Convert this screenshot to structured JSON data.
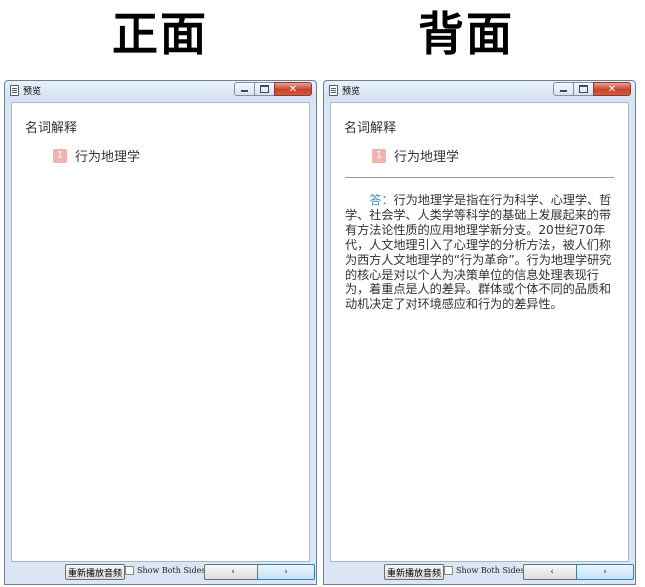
{
  "headings": {
    "front": "正面",
    "back": "背面"
  },
  "windows": [
    {
      "title": "预览",
      "category": "名词解释",
      "item_number": "1",
      "term": "行为地理学",
      "show_answer": false,
      "answer_label": "",
      "answer_text": "",
      "replay_label": "重新播放音频",
      "show_both_label": "Show Both Sides",
      "prev_icon": "‹",
      "next_icon": "›"
    },
    {
      "title": "预览",
      "category": "名词解释",
      "item_number": "1",
      "term": "行为地理学",
      "show_answer": true,
      "answer_label": "答：",
      "answer_text": "行为地理学是指在行为科学、心理学、哲学、社会学、人类学等科学的基础上发展起来的带有方法论性质的应用地理学新分支。20世纪70年代，人文地理引入了心理学的分析方法，被人们称为西方人文地理学的“行为革命”。行为地理学研究的核心是对以个人为决策单位的信息处理表现行为，着重点是人的差异。群体或个体不同的品质和动机决定了对环境感应和行为的差异性。",
      "replay_label": "重新播放音频",
      "show_both_label": "Show Both Sides",
      "prev_icon": "‹",
      "next_icon": "›"
    }
  ],
  "colors": {
    "badge": "#f2b2b2",
    "answer_label": "#4a8fb5",
    "close_button": "#c7432c"
  }
}
